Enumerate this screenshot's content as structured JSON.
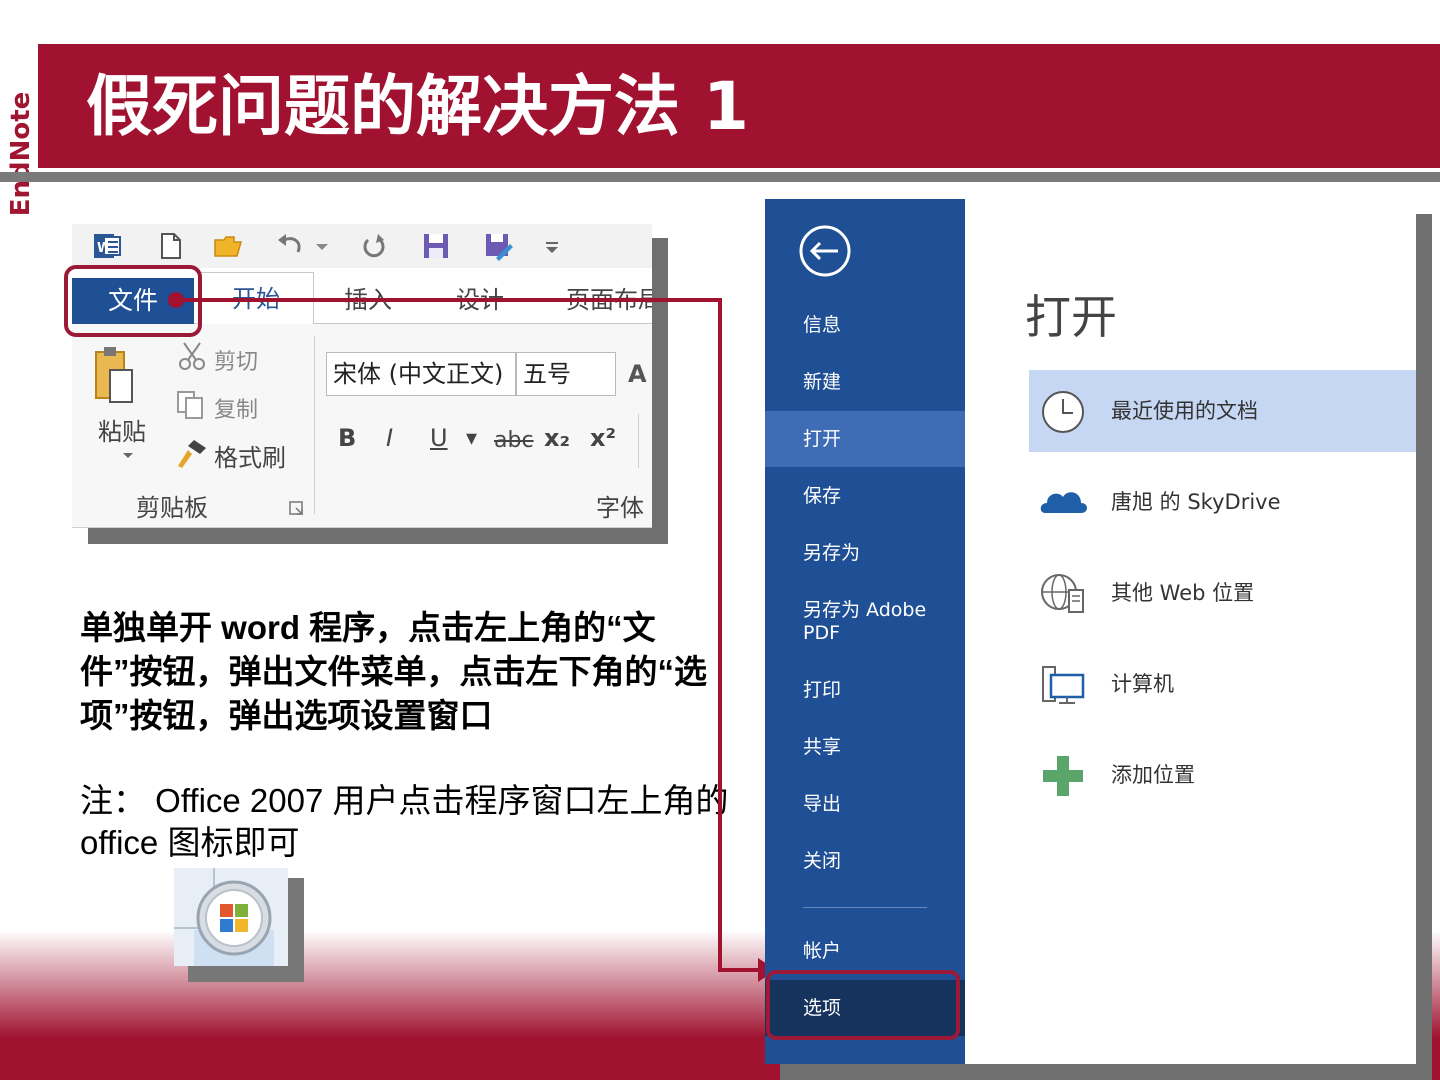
{
  "logo": {
    "text": "EndNote"
  },
  "title": "假死问题的解决方法 1",
  "ribbon": {
    "tabs": {
      "file": "文件",
      "home": "开始",
      "insert": "插入",
      "design": "设计",
      "layout": "页面布局"
    },
    "clipboard": {
      "paste": "粘贴",
      "cut": "剪切",
      "copy": "复制",
      "format_painter": "格式刷",
      "group": "剪贴板"
    },
    "font": {
      "font_name": "宋体 (中文正文)",
      "font_size": "五号",
      "group": "字体",
      "bold": "B",
      "italic": "I",
      "underline": "U",
      "strike": "abc",
      "subscript": "x₂",
      "superscript": "x²",
      "grow": "A"
    }
  },
  "instruction": "单独单开 word 程序，点击左上角的“文件”按钮，弹出文件菜单，点击左下角的“选项”按钮，弹出选项设置窗口",
  "note": "注： Office 2007 用户点击程序窗口左上角的 office 图标即可",
  "backstage": {
    "menu": [
      "信息",
      "新建",
      "打开",
      "保存",
      "另存为",
      "另存为 Adobe PDF",
      "打印",
      "共享",
      "导出",
      "关闭"
    ],
    "account": "帐户",
    "options": "选项",
    "heading": "打开",
    "locations": [
      "最近使用的文档",
      "唐旭 的 SkyDrive",
      "其他 Web 位置",
      "计算机",
      "添加位置"
    ]
  },
  "colors": {
    "brand": "#a01230",
    "office_blue": "#1f4f94",
    "highlight": "#9b1a37"
  }
}
